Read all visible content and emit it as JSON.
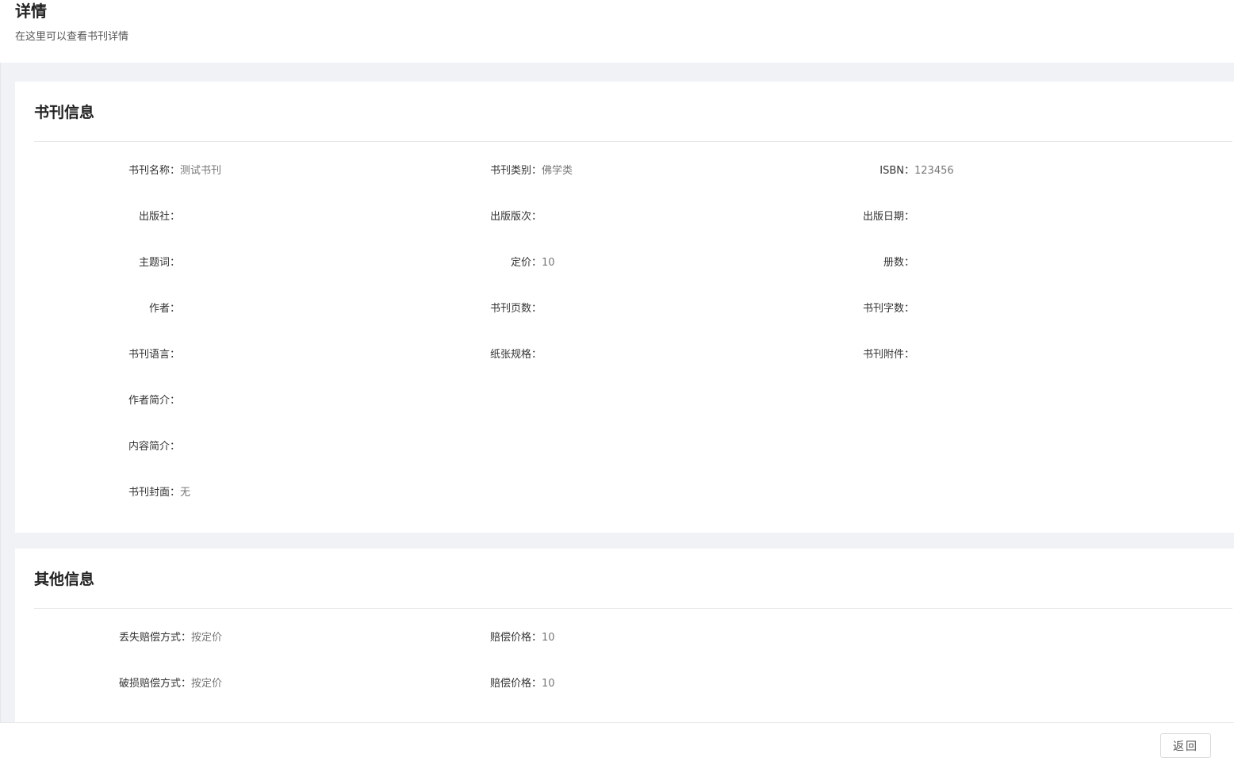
{
  "header": {
    "title": "详情",
    "subtitle": "在这里可以查看书刊详情"
  },
  "book_info": {
    "title": "书刊信息",
    "rows": [
      [
        {
          "label": "书刊名称：",
          "value": "测试书刊"
        },
        {
          "label": "书刊类别：",
          "value": "佛学类"
        },
        {
          "label": "ISBN：",
          "value": "123456"
        }
      ],
      [
        {
          "label": "出版社：",
          "value": ""
        },
        {
          "label": "出版版次：",
          "value": ""
        },
        {
          "label": "出版日期：",
          "value": ""
        }
      ],
      [
        {
          "label": "主题词：",
          "value": ""
        },
        {
          "label": "定价：",
          "value": "10"
        },
        {
          "label": "册数：",
          "value": ""
        }
      ],
      [
        {
          "label": "作者：",
          "value": ""
        },
        {
          "label": "书刊页数：",
          "value": ""
        },
        {
          "label": "书刊字数：",
          "value": ""
        }
      ],
      [
        {
          "label": "书刊语言：",
          "value": ""
        },
        {
          "label": "纸张规格：",
          "value": ""
        },
        {
          "label": "书刊附件：",
          "value": ""
        }
      ],
      [
        {
          "label": "作者简介：",
          "value": ""
        }
      ],
      [
        {
          "label": "内容简介：",
          "value": ""
        }
      ],
      [
        {
          "label": "书刊封面：",
          "value": "无"
        }
      ]
    ]
  },
  "other_info": {
    "title": "其他信息",
    "rows": [
      [
        {
          "label": "丢失赔偿方式：",
          "value": "按定价"
        },
        {
          "label": "赔偿价格：",
          "value": "10"
        }
      ],
      [
        {
          "label": "破损赔偿方式：",
          "value": "按定价"
        },
        {
          "label": "赔偿价格：",
          "value": "10"
        }
      ]
    ]
  },
  "footer": {
    "back_label": "返回"
  }
}
